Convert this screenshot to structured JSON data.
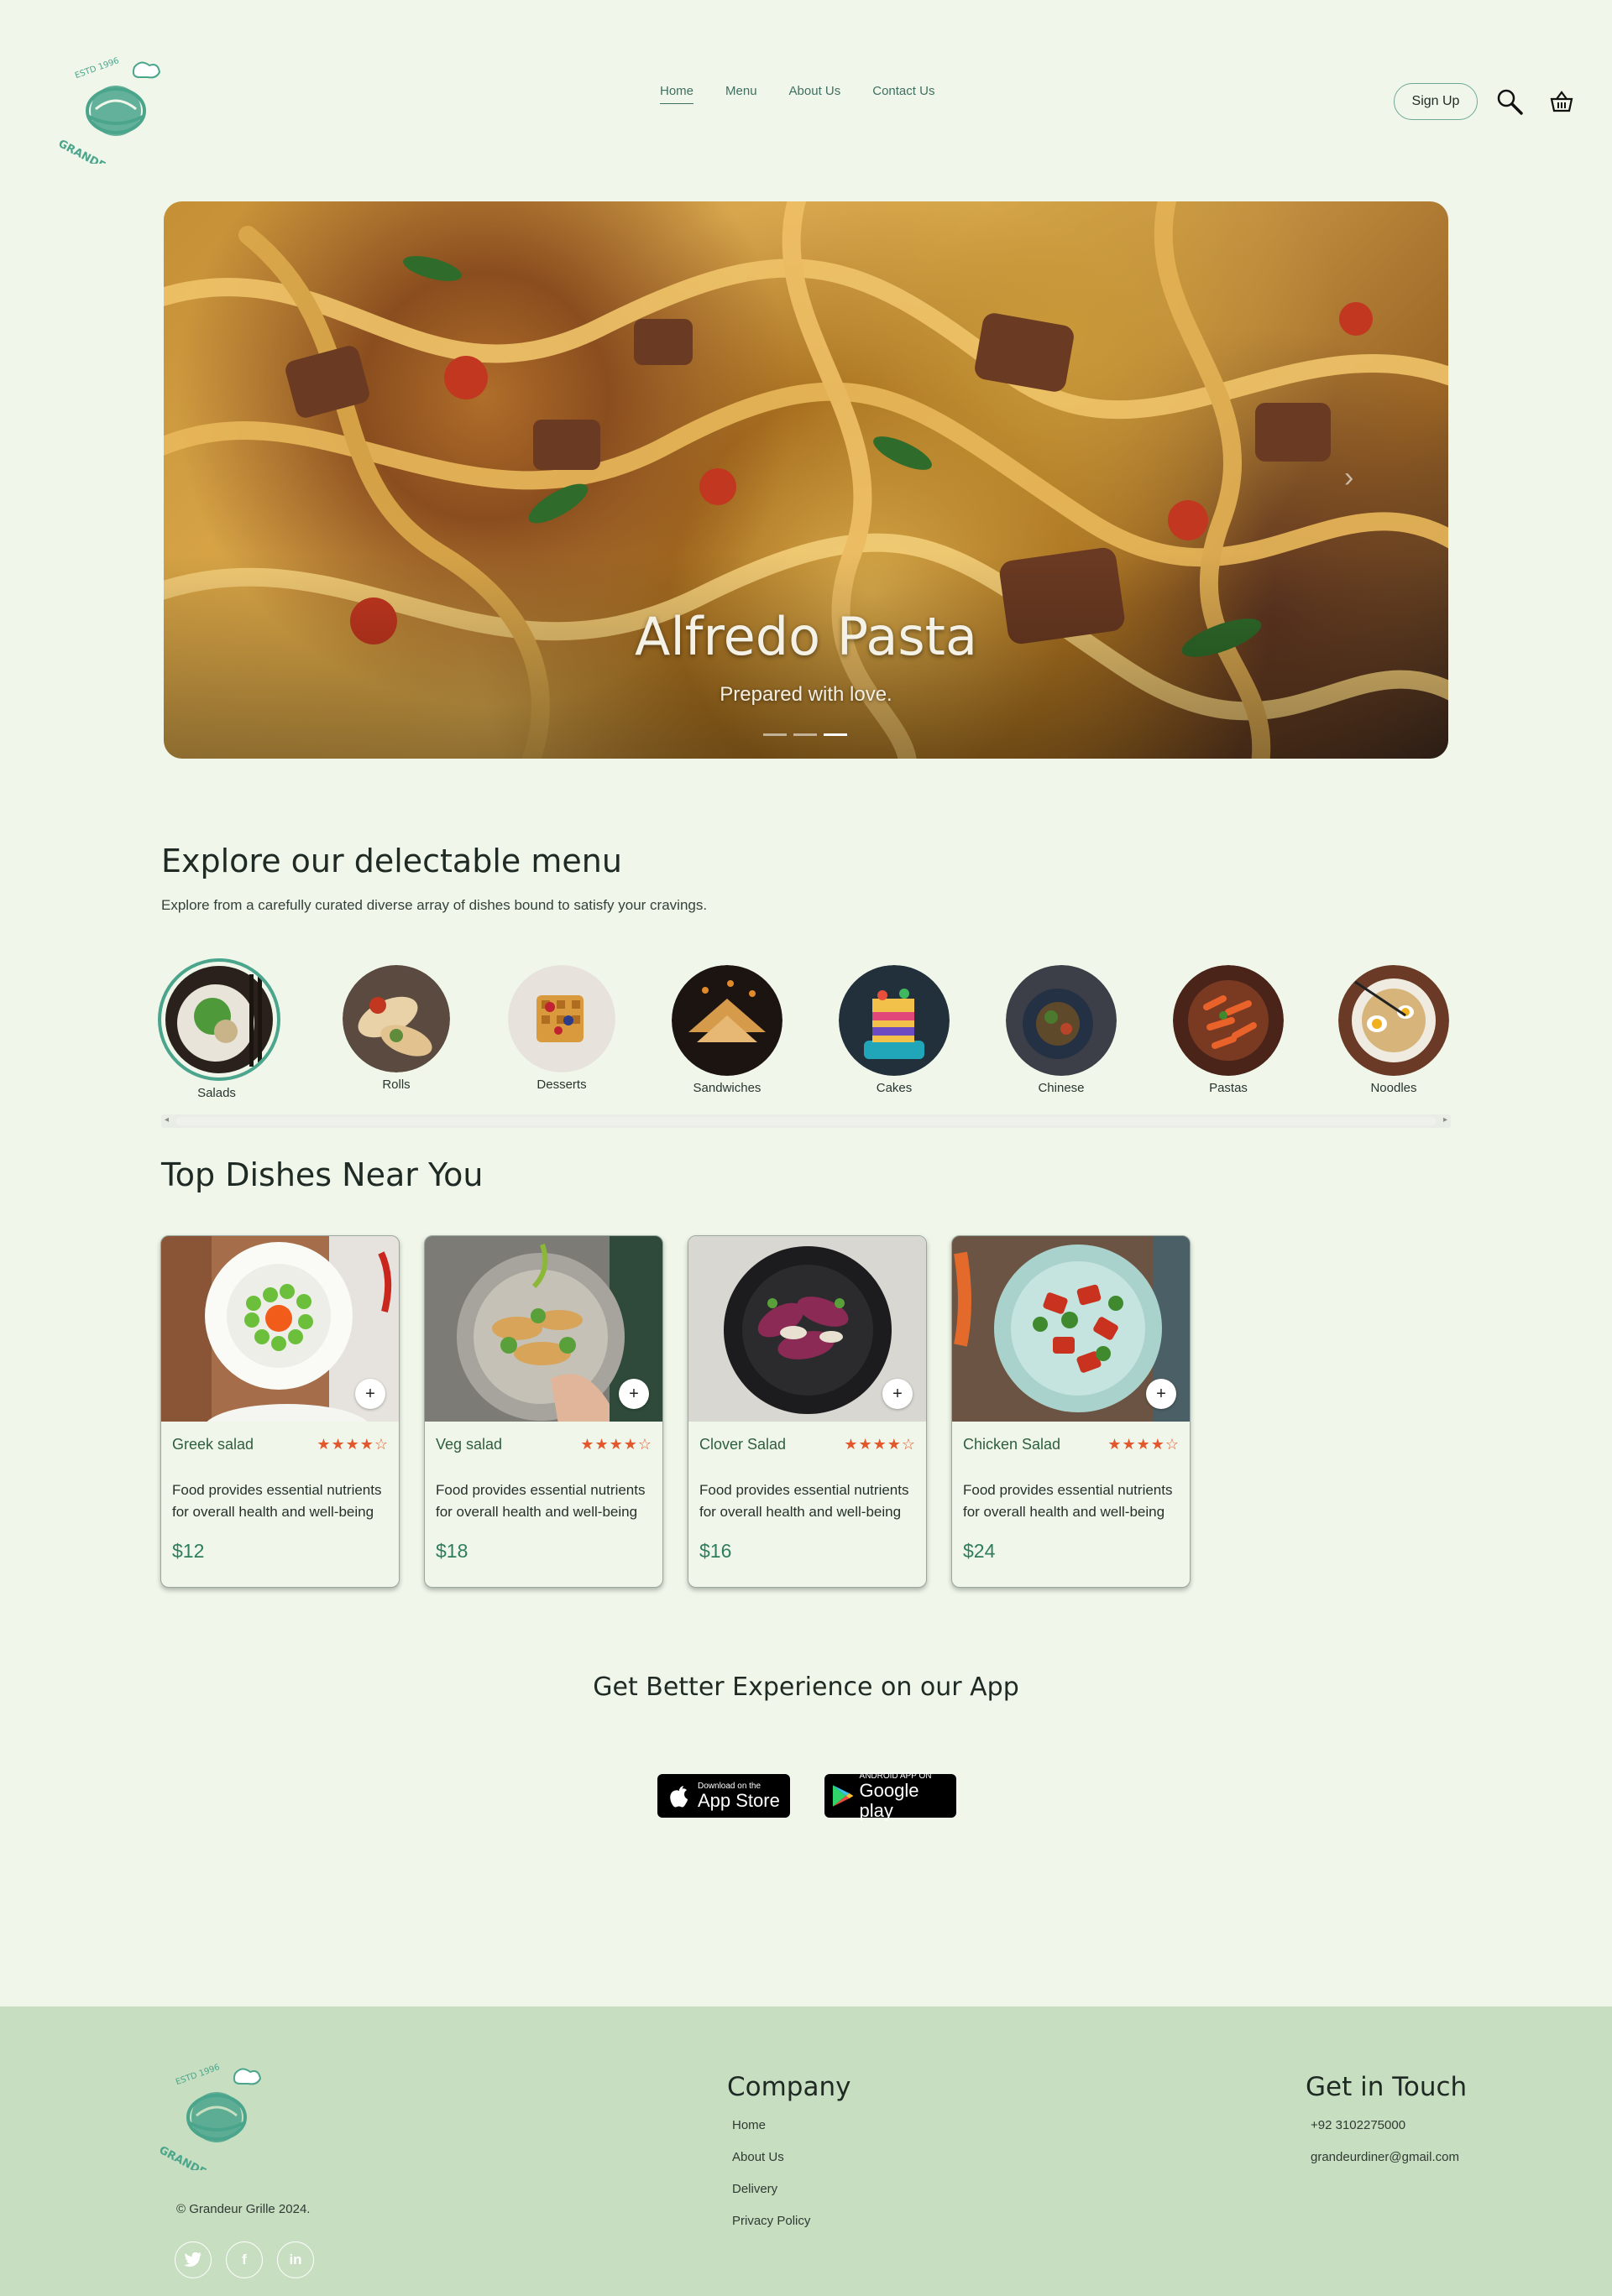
{
  "brand": {
    "logo_text": "GRANDEUR GRILLE",
    "est": "ESTD 1996"
  },
  "nav": {
    "items": [
      "Home",
      "Menu",
      "About Us",
      "Contact Us"
    ],
    "active": "Home"
  },
  "header": {
    "signup_label": "Sign Up"
  },
  "hero": {
    "title": "Alfredo Pasta",
    "subtitle": "Prepared with love."
  },
  "menu_section": {
    "title": "Explore our delectable menu",
    "description": "Explore from a carefully curated diverse array of dishes bound to satisfy your cravings.",
    "categories": [
      "Salads",
      "Rolls",
      "Desserts",
      "Sandwiches",
      "Cakes",
      "Chinese",
      "Pastas",
      "Noodles"
    ]
  },
  "dishes_section": {
    "title": "Top Dishes Near You",
    "dishes": [
      {
        "name": "Greek salad",
        "rating": 4,
        "stars": "★★★★☆",
        "description": "Food provides essential nutrients for overall health and well-being",
        "price": "$12"
      },
      {
        "name": "Veg salad",
        "rating": 4,
        "stars": "★★★★☆",
        "description": "Food provides essential nutrients for overall health and well-being",
        "price": "$18"
      },
      {
        "name": "Clover Salad",
        "rating": 4,
        "stars": "★★★★☆",
        "description": "Food provides essential nutrients for overall health and well-being",
        "price": "$16"
      },
      {
        "name": "Chicken Salad",
        "rating": 4,
        "stars": "★★★★☆",
        "description": "Food provides essential nutrients for overall health and well-being",
        "price": "$24"
      }
    ]
  },
  "app_section": {
    "title": "Get Better Experience on our App",
    "app_store": {
      "small": "Download on the",
      "big": "App Store"
    },
    "google_play": {
      "small": "ANDROID APP ON",
      "big": "Google play"
    }
  },
  "footer": {
    "copyright": "© Grandeur Grille 2024.",
    "company_heading": "Company",
    "company_links": [
      "Home",
      "About Us",
      "Delivery",
      "Privacy Policy"
    ],
    "contact_heading": "Get in Touch",
    "phone": "+92 3102275000",
    "email": "grandeurdiner@gmail.com",
    "social": [
      "twitter-icon",
      "facebook-icon",
      "linkedin-icon"
    ]
  },
  "colors": {
    "background": "#f0f7ea",
    "accent": "#4aa58c",
    "footer": "#c7dfc0",
    "price": "#2e7d5b",
    "stars": "#e2572b"
  }
}
